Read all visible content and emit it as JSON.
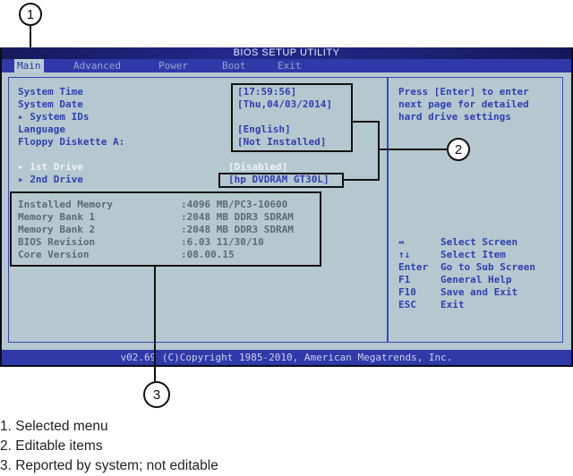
{
  "callouts": {
    "one": "1",
    "two": "2",
    "three": "3"
  },
  "bios": {
    "title": "BIOS SETUP UTILITY",
    "menu": [
      {
        "label": "Main",
        "selected": true
      },
      {
        "label": "Advanced",
        "selected": false
      },
      {
        "label": "Power",
        "selected": false
      },
      {
        "label": "Boot",
        "selected": false
      },
      {
        "label": "Exit",
        "selected": false
      }
    ],
    "settings": [
      {
        "label": "System Time",
        "value": "[17:59:56]"
      },
      {
        "label": "System Date",
        "value": "[Thu,04/03/2014]"
      },
      {
        "label": "▸ System IDs",
        "value": ""
      },
      {
        "label": "Language",
        "value": "[English]"
      },
      {
        "label": "Floppy Diskette A:",
        "value": "[Not Installed]"
      }
    ],
    "drives": [
      {
        "label": "▸ 1st Drive",
        "value": "[Disabled]",
        "highlighted": true
      },
      {
        "label": "▸ 2nd Drive",
        "value": "[hp DVDRAM GT30L]",
        "highlighted": false
      }
    ],
    "system_info": [
      {
        "label": "Installed Memory",
        "value": ":4096 MB/PC3-10600"
      },
      {
        "label": "Memory Bank 1",
        "value": ":2048 MB DDR3 SDRAM"
      },
      {
        "label": "Memory Bank 2",
        "value": ":2048 MB DDR3 SDRAM"
      },
      {
        "label": "BIOS Revision",
        "value": ":6.03 11/30/10"
      },
      {
        "label": "Core Version",
        "value": ":08.00.15"
      }
    ],
    "help_text": [
      "Press [Enter] to enter",
      "next page for detailed",
      "hard drive settings"
    ],
    "keys": [
      {
        "key": "↔",
        "action": "Select Screen"
      },
      {
        "key": "↑↓",
        "action": "Select Item"
      },
      {
        "key": "Enter",
        "action": "Go to Sub Screen"
      },
      {
        "key": "F1",
        "action": "General Help"
      },
      {
        "key": "F10",
        "action": "Save and Exit"
      },
      {
        "key": "ESC",
        "action": "Exit"
      }
    ],
    "footer": "v02.69 (C)Copyright 1985-2010, American Megatrends, Inc."
  },
  "legend": [
    "1. Selected menu",
    "2. Editable items",
    "3. Reported by system; not editable"
  ],
  "colors": {
    "bios_blue": "#2f3aa8",
    "bios_background": "#b5c8cf",
    "text_blue": "#3040b0"
  }
}
